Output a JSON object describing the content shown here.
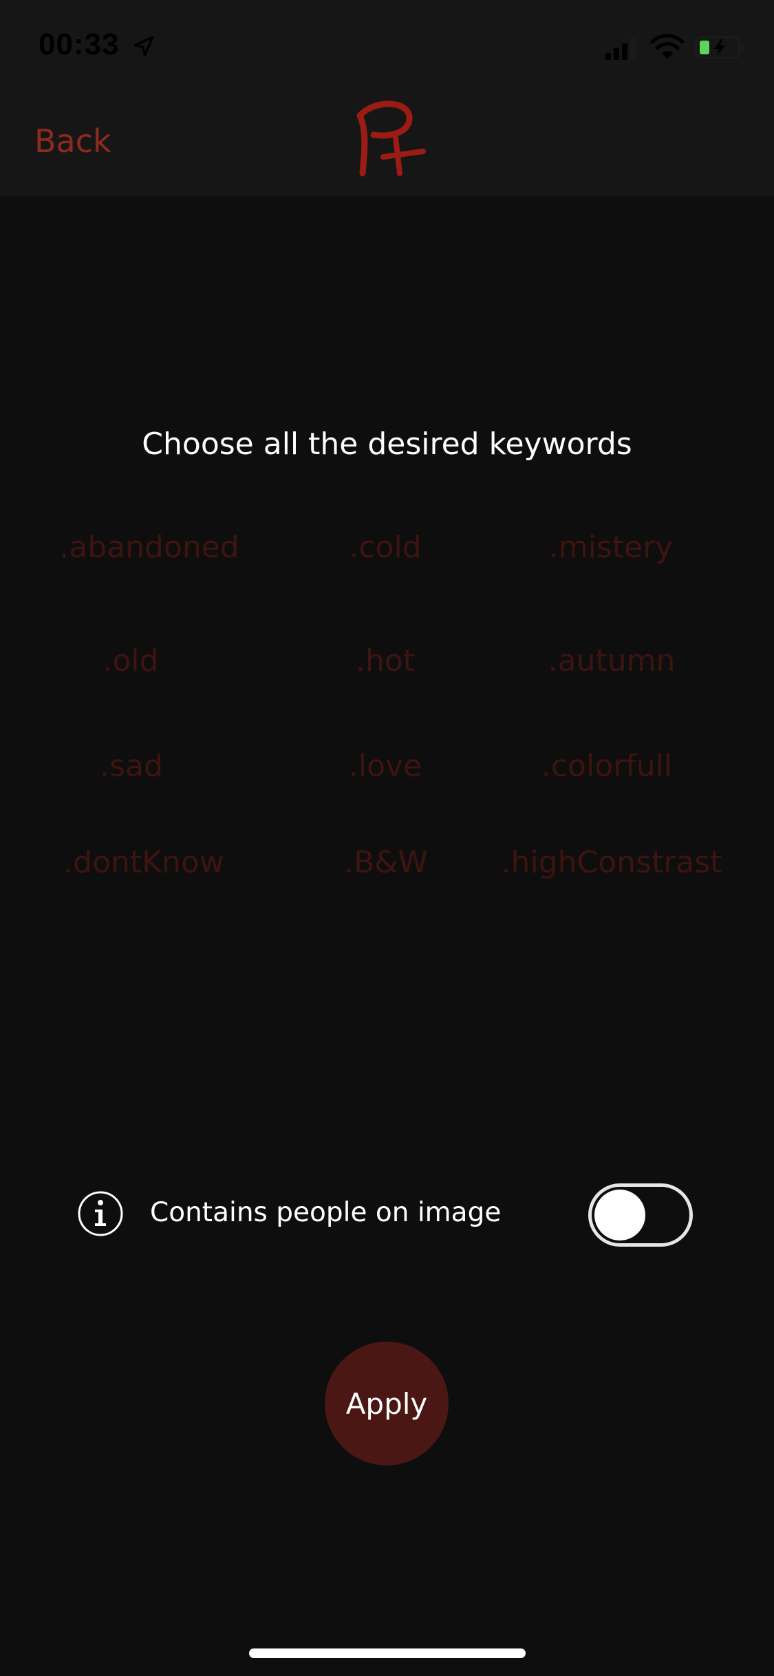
{
  "status_bar": {
    "time": "00:33"
  },
  "nav": {
    "back_label": "Back",
    "logo_text": "P+"
  },
  "main": {
    "prompt": "Choose all the desired keywords",
    "keywords": [
      ".abandoned",
      ".cold",
      ".mistery",
      ".old",
      ".hot",
      ".autumn",
      ".sad",
      ".love",
      ".colorfull",
      ".dontKnow",
      ".B&W",
      ".highConstrast"
    ]
  },
  "people_option": {
    "label": "Contains people on image",
    "toggle_on": false
  },
  "apply_label": "Apply",
  "colors": {
    "accent": "#8e2a20",
    "keyword_inactive": "#3d1410",
    "apply_background": "#4a1714",
    "background": "#0e0e0e",
    "header_background": "#161616"
  }
}
